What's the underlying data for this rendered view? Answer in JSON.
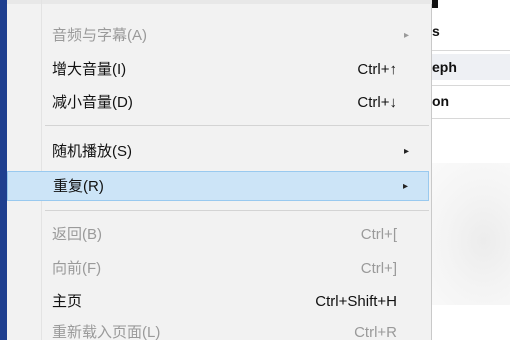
{
  "background": {
    "rows": [
      "s",
      "eph",
      "on"
    ]
  },
  "menu": {
    "items": [
      {
        "label": "音频与字幕(A)",
        "shortcut": "",
        "arrow": "▸",
        "disabled": true
      },
      {
        "label": "增大音量(I)",
        "shortcut": "Ctrl+↑",
        "arrow": "",
        "disabled": false
      },
      {
        "label": "减小音量(D)",
        "shortcut": "Ctrl+↓",
        "arrow": "",
        "disabled": false
      },
      {
        "label": "随机播放(S)",
        "shortcut": "",
        "arrow": "▸",
        "disabled": false
      },
      {
        "label": "重复(R)",
        "shortcut": "",
        "arrow": "▸",
        "disabled": false,
        "highlighted": true
      },
      {
        "label": "返回(B)",
        "shortcut": "Ctrl+[",
        "arrow": "",
        "disabled": true
      },
      {
        "label": "向前(F)",
        "shortcut": "Ctrl+]",
        "arrow": "",
        "disabled": true
      },
      {
        "label": "主页",
        "shortcut": "Ctrl+Shift+H",
        "arrow": "",
        "disabled": false
      },
      {
        "label": "重新载入页面(L)",
        "shortcut": "Ctrl+R",
        "arrow": "",
        "disabled": true
      }
    ]
  }
}
